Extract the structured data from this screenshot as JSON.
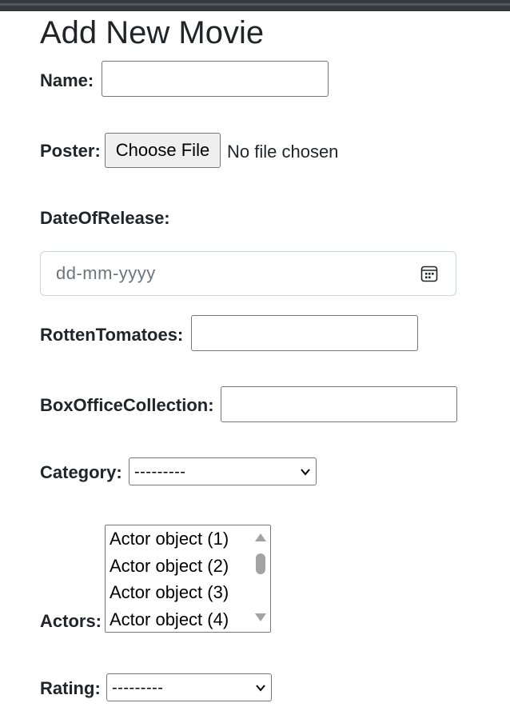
{
  "page": {
    "title": "Add New Movie"
  },
  "form": {
    "name": {
      "label": "Name:",
      "value": ""
    },
    "poster": {
      "label": "Poster:",
      "button_label": "Choose File",
      "status": "No file chosen"
    },
    "date_of_release": {
      "label": "DateOfRelease:",
      "placeholder": "dd-mm-yyyy"
    },
    "rotten_tomatoes": {
      "label": "RottenTomatoes:",
      "value": ""
    },
    "box_office_collection": {
      "label": "BoxOfficeCollection:",
      "value": ""
    },
    "category": {
      "label": "Category:",
      "selected": "---------"
    },
    "actors": {
      "label": "Actors:",
      "options": [
        "Actor object (1)",
        "Actor object (2)",
        "Actor object (3)",
        "Actor object (4)"
      ]
    },
    "rating": {
      "label": "Rating:",
      "selected": "---------"
    }
  },
  "icons": {
    "date_picker": "calendar-icon",
    "select_arrow": "chevron-down-icon",
    "scroll_up": "triangle-up-icon",
    "scroll_down": "triangle-down-icon"
  },
  "colors": {
    "topbar": "#343a40",
    "text": "#212529",
    "placeholder": "#6c757d",
    "input_border": "#767676",
    "date_border": "#ced4da",
    "file_button_bg": "#efefef"
  }
}
